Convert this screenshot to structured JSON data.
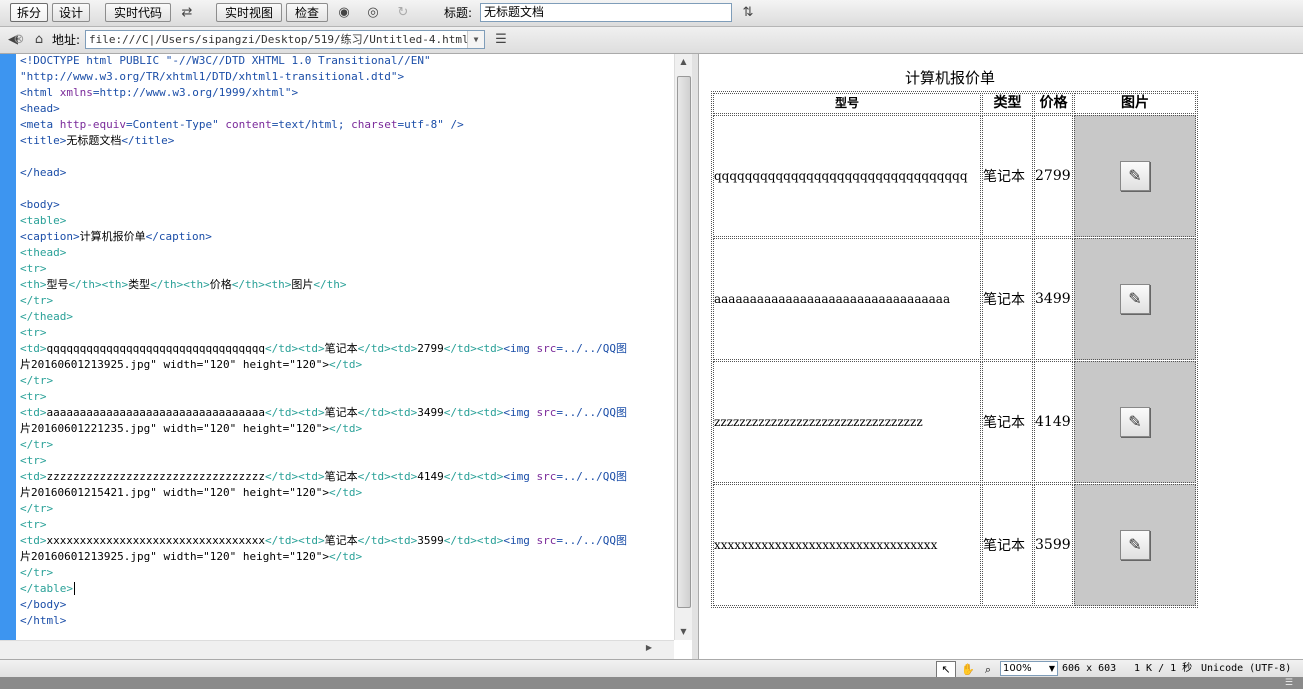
{
  "toolbar": {
    "split_label": "拆分",
    "design_label": "设计",
    "live_code_label": "实时代码",
    "live_view_label": "实时视图",
    "inspect_label": "检查",
    "title_label": "标题:",
    "title_value": "无标题文档"
  },
  "address": {
    "label": "地址:",
    "value": "file:///C|/Users/sipangzi/Desktop/519/练习/Untitled-4.html"
  },
  "code_lines": [
    "<!DOCTYPE html PUBLIC \"-//W3C//DTD XHTML 1.0 Transitional//EN\"",
    "\"http://www.w3.org/TR/xhtml1/DTD/xhtml1-transitional.dtd\">",
    "<html xmlns=\"http://www.w3.org/1999/xhtml\">",
    "<head>",
    "<meta http-equiv=\"Content-Type\" content=\"text/html; charset=utf-8\" />",
    "<title>无标题文档</title>",
    "",
    "</head>",
    "",
    "<body>",
    "<table>",
    "<caption>计算机报价单</caption>",
    "<thead>",
    "<tr>",
    "<th>型号</th><th>类型</th><th>价格</th><th>图片</th>",
    "</tr>",
    "</thead>",
    "<tr>",
    "<td>qqqqqqqqqqqqqqqqqqqqqqqqqqqqqqqqq</td><td>笔记本</td><td>2799</td><td><img src=\"../../QQ图",
    "片20160601213925.jpg\" width=\"120\" height=\"120\"></td>",
    "</tr>",
    "<tr>",
    "<td>aaaaaaaaaaaaaaaaaaaaaaaaaaaaaaaaa</td><td>笔记本</td><td>3499</td><td><img src=\"../../QQ图",
    "片20160601221235.jpg\" width=\"120\" height=\"120\"></td>",
    "</tr>",
    "<tr>",
    "<td>zzzzzzzzzzzzzzzzzzzzzzzzzzzzzzzzz</td><td>笔记本</td><td>4149</td><td><img src=\"../../QQ图",
    "片20160601215421.jpg\" width=\"120\" height=\"120\"></td>",
    "</tr>",
    "<tr>",
    "<td>xxxxxxxxxxxxxxxxxxxxxxxxxxxxxxxxx</td><td>笔记本</td><td>3599</td><td><img src=\"../../QQ图",
    "片20160601213925.jpg\" width=\"120\" height=\"120\"></td>",
    "</tr>",
    "</table>",
    "</body>",
    "</html>"
  ],
  "preview": {
    "caption": "计算机报价单",
    "headers": [
      "型号",
      "类型",
      "价格",
      "图片"
    ],
    "rows": [
      {
        "model": "qqqqqqqqqqqqqqqqqqqqqqqqqqqqqqqqq",
        "type": "笔记本",
        "price": "2799"
      },
      {
        "model": "aaaaaaaaaaaaaaaaaaaaaaaaaaaaaaaaa",
        "type": "笔记本",
        "price": "3499"
      },
      {
        "model": "zzzzzzzzzzzzzzzzzzzzzzzzzzzzzzzzz",
        "type": "笔记本",
        "price": "4149"
      },
      {
        "model": "xxxxxxxxxxxxxxxxxxxxxxxxxxxxxxxxx",
        "type": "笔记本",
        "price": "3599"
      }
    ]
  },
  "status": {
    "zoom": "100%",
    "dimensions": "606 x 603",
    "size_time": "1 K / 1 秒",
    "encoding": "Unicode (UTF-8)"
  },
  "colors": {
    "gutter": "#3d95f0",
    "tag": "#1b4ea8",
    "teal_tag": "#2aa198",
    "attribute": "#7a2a9a"
  }
}
